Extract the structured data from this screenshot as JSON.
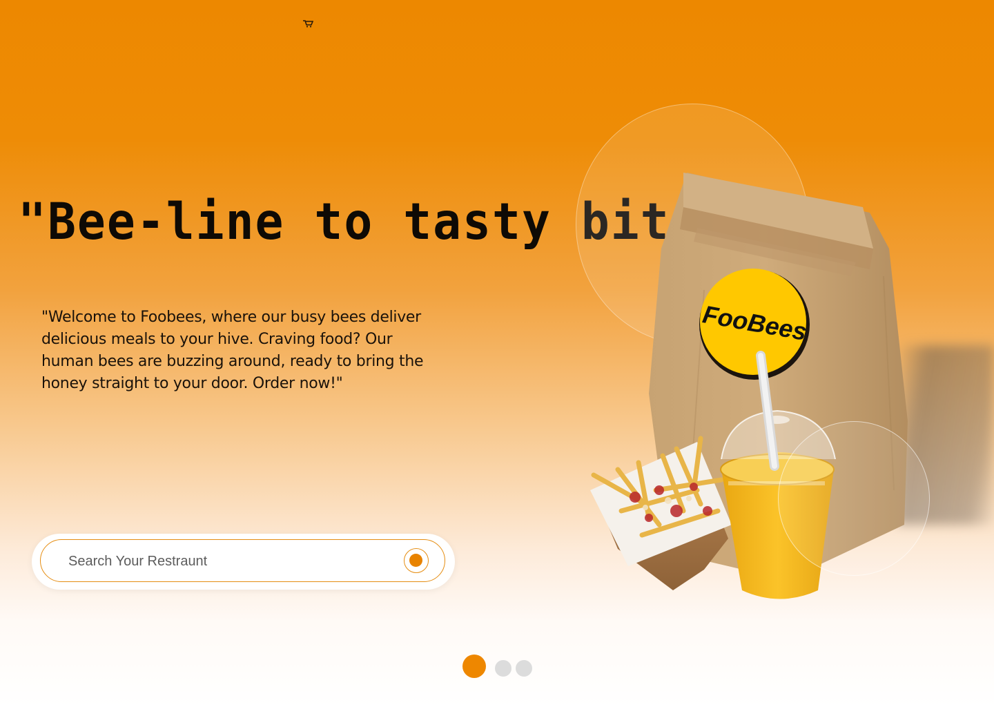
{
  "header": {
    "cart_icon": "cart-icon"
  },
  "hero": {
    "headline": "\"Bee-line to tasty bites!\"",
    "intro": "\"Welcome to Foobees, where our busy bees deliver delicious meals to your hive. Craving food? Our human bees are buzzing around, ready to bring the honey straight to your door. Order now!\""
  },
  "search": {
    "placeholder": "Search Your Restraunt",
    "button_icon": "search-submit-icon"
  },
  "product": {
    "brand_label": "FooBees"
  },
  "carousel": {
    "slide_count": 3,
    "active_index": 0
  },
  "colors": {
    "accent": "#ED8800",
    "brand_yellow": "#FFC800",
    "text": "#0E0A05"
  }
}
